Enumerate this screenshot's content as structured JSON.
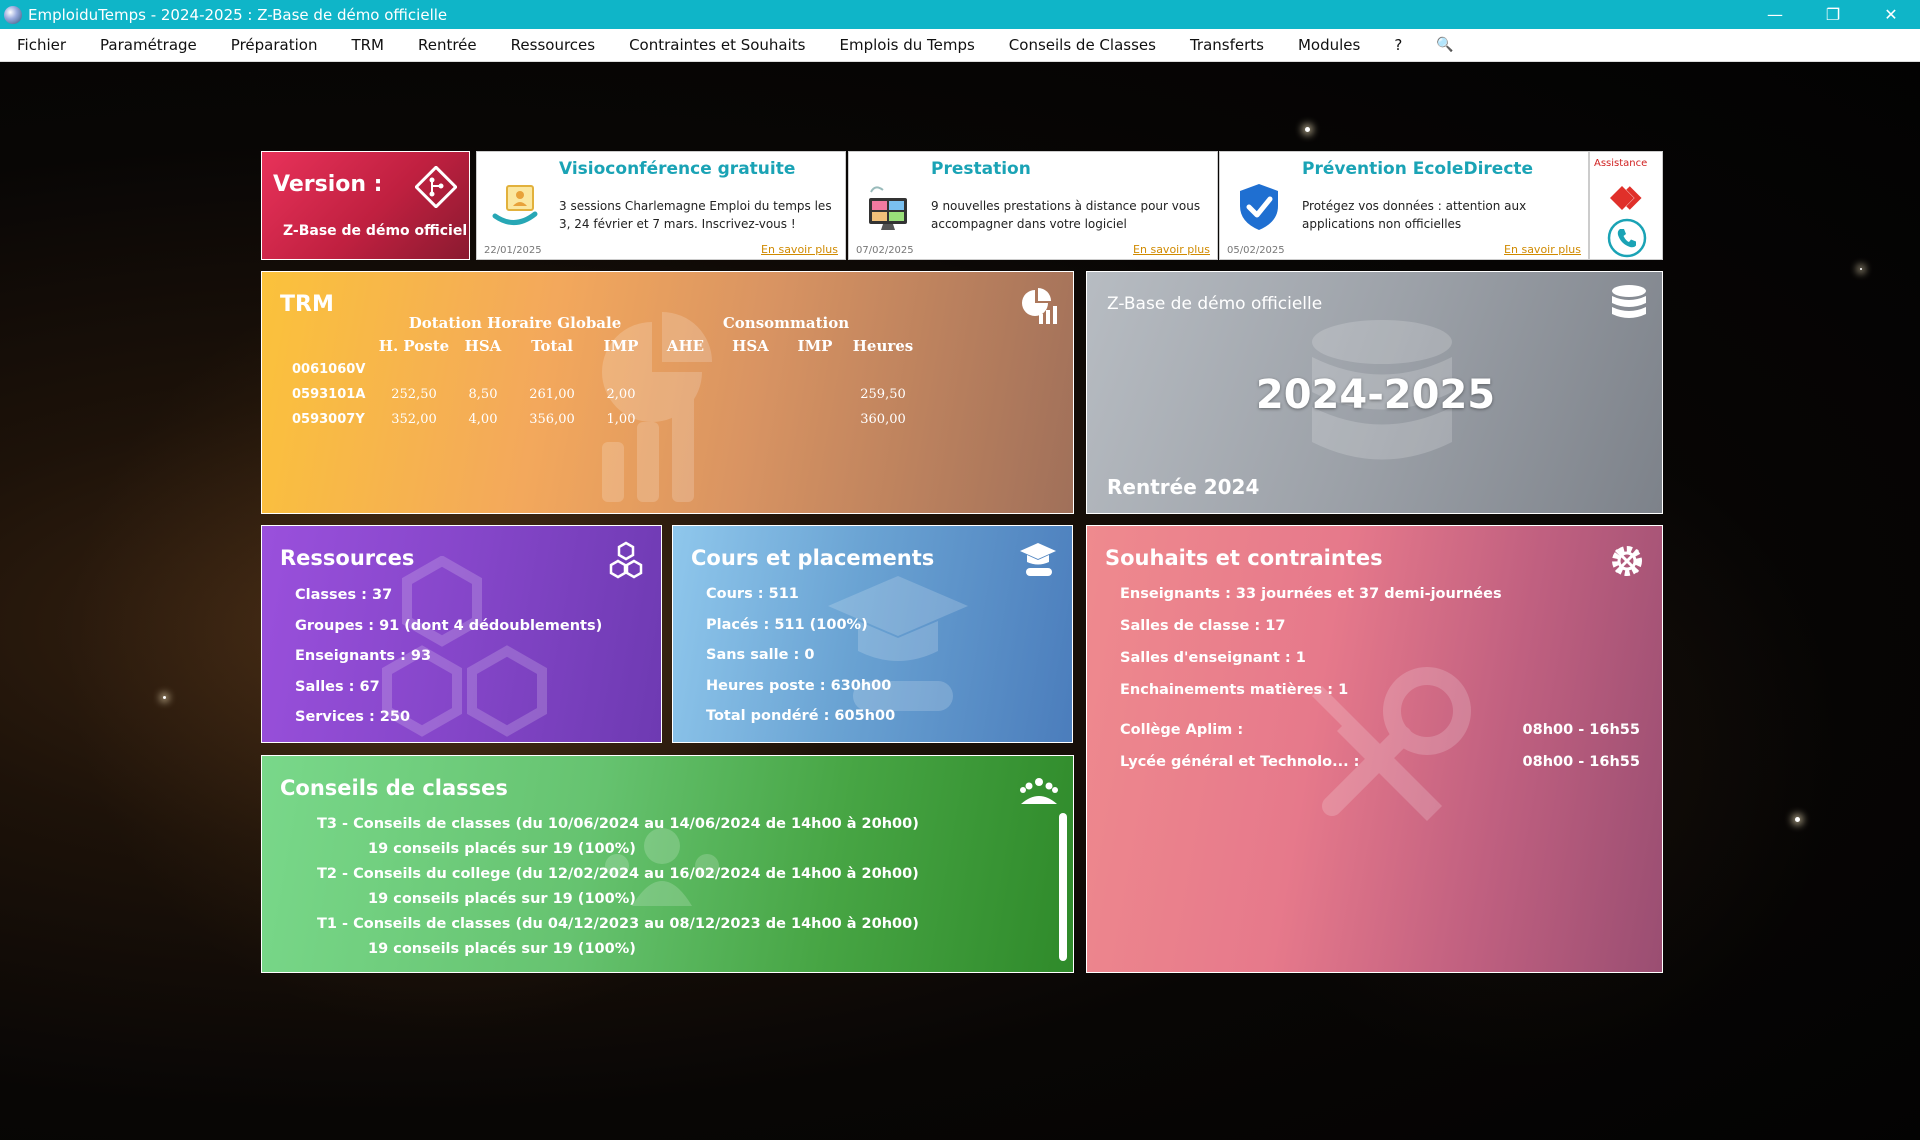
{
  "window": {
    "title": "EmploiduTemps - 2024-2025 : Z-Base de démo officielle",
    "minimize": "—",
    "restore": "❐",
    "close": "✕"
  },
  "menu": {
    "items": [
      "Fichier",
      "Paramétrage",
      "Préparation",
      "TRM",
      "Rentrée",
      "Ressources",
      "Contraintes et Souhaits",
      "Emplois du Temps",
      "Conseils de Classes",
      "Transferts",
      "Modules",
      "?"
    ],
    "search_icon": "🔍"
  },
  "version": {
    "label": "Version :",
    "selected": "Z-Base de démo officiel",
    "caret": "▾"
  },
  "news": [
    {
      "title": "Visioconférence gratuite",
      "text": "3 sessions Charlemagne Emploi du temps les 3, 24 février et 7 mars. Inscrivez-vous !",
      "date": "22/01/2025",
      "link": "En savoir plus"
    },
    {
      "title": "Prestation",
      "text": "9 nouvelles prestations à distance pour vous accompagner dans votre logiciel",
      "date": "07/02/2025",
      "link": "En savoir plus"
    },
    {
      "title": "Prévention EcoleDirecte",
      "text": "Protégez vos données : attention aux applications non officielles",
      "date": "05/02/2025",
      "link": "En savoir plus"
    }
  ],
  "assistance": {
    "label": "Assistance"
  },
  "trm": {
    "title": "TRM",
    "group_dhg": "Dotation Horaire Globale",
    "group_conso": "Consommation",
    "columns": [
      "H. Poste",
      "HSA",
      "Total",
      "IMP",
      "AHE",
      "HSA",
      "IMP",
      "Heures"
    ],
    "rows": [
      {
        "code": "0061060V",
        "cells": [
          "",
          "",
          "",
          "",
          "",
          "",
          "",
          ""
        ]
      },
      {
        "code": "0593101A",
        "cells": [
          "252,50",
          "8,50",
          "261,00",
          "2,00",
          "",
          "",
          "",
          "259,50"
        ]
      },
      {
        "code": "0593007Y",
        "cells": [
          "352,00",
          "4,00",
          "356,00",
          "1,00",
          "",
          "",
          "",
          "360,00"
        ]
      }
    ]
  },
  "zbase": {
    "title": "Z-Base de démo officielle",
    "year": "2024-2025",
    "rentree": "Rentrée 2024"
  },
  "ressources": {
    "title": "Ressources",
    "items": [
      "Classes : 37",
      "Groupes : 91 (dont 4 dédoublements)",
      "Enseignants : 93",
      "Salles : 67",
      "Services : 250"
    ]
  },
  "cours": {
    "title": "Cours et placements",
    "items": [
      "Cours : 511",
      "Placés : 511 (100%)",
      "Sans salle : 0",
      "Heures poste : 630h00",
      "Total pondéré : 605h00"
    ]
  },
  "souhaits": {
    "title": "Souhaits et contraintes",
    "items": [
      "Enseignants : 33 journées et 37 demi-journées",
      "Salles de classe : 17",
      "Salles d'enseignant : 1",
      "Enchainements matières : 1"
    ],
    "schedules": [
      {
        "name": "Collège Aplim :",
        "hours": "08h00 - 16h55"
      },
      {
        "name": "Lycée général et Technolo... :",
        "hours": "08h00 - 16h55"
      }
    ]
  },
  "conseils": {
    "title": "Conseils de classes",
    "items": [
      {
        "period": "T3 - Conseils de classes (du 10/06/2024 au 14/06/2024 de 14h00 à 20h00)",
        "count": "19 conseils placés sur 19 (100%)"
      },
      {
        "period": "T2 - Conseils du college (du 12/02/2024 au 16/02/2024 de 14h00 à 20h00)",
        "count": "19 conseils placés sur 19 (100%)"
      },
      {
        "period": "T1 - Conseils de classes (du 04/12/2023 au 08/12/2023 de 14h00 à 20h00)",
        "count": "19 conseils placés sur 19 (100%)"
      }
    ]
  }
}
